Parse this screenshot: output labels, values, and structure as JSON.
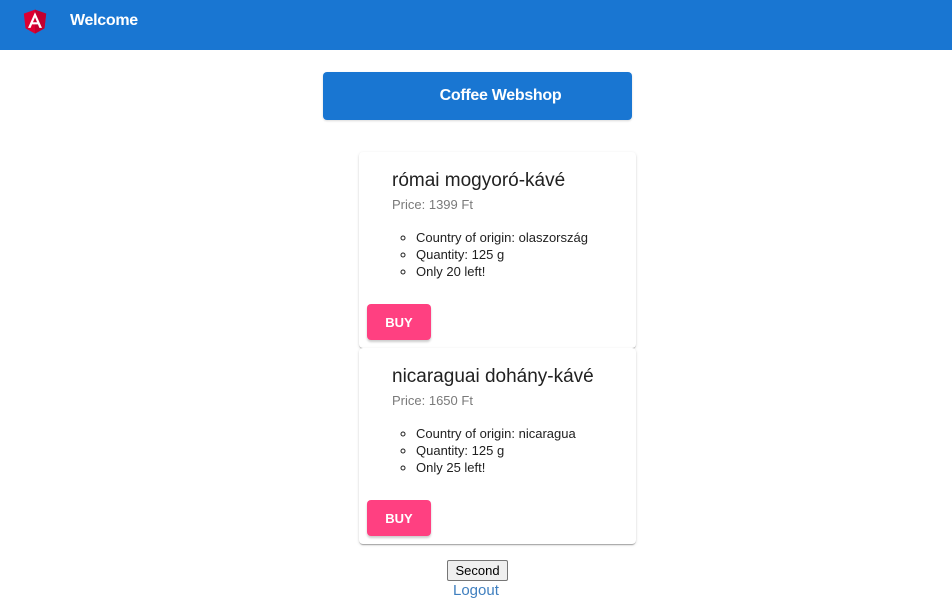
{
  "toolbar": {
    "logo_icon": "angular-logo-icon",
    "title": "Welcome",
    "color": "#1976d2"
  },
  "main": {
    "shop_button_label": "Coffee Webshop"
  },
  "products": [
    {
      "name": "római mogyoró-kávé",
      "price": "Price: 1399 Ft",
      "details": [
        "Country of origin: olaszország",
        "Quantity: 125 g",
        "Only 20 left!"
      ],
      "buy_label": "BUY"
    },
    {
      "name": "nicaraguai dohány-kávé",
      "price": "Price: 1650 Ft",
      "details": [
        "Country of origin: nicaragua",
        "Quantity: 125 g",
        "Only 25 left!"
      ],
      "buy_label": "BUY"
    }
  ],
  "footer": {
    "second_button_label": "Second",
    "logout_label": "Logout"
  },
  "colors": {
    "primary": "#1976d2",
    "accent": "#ff4081"
  }
}
